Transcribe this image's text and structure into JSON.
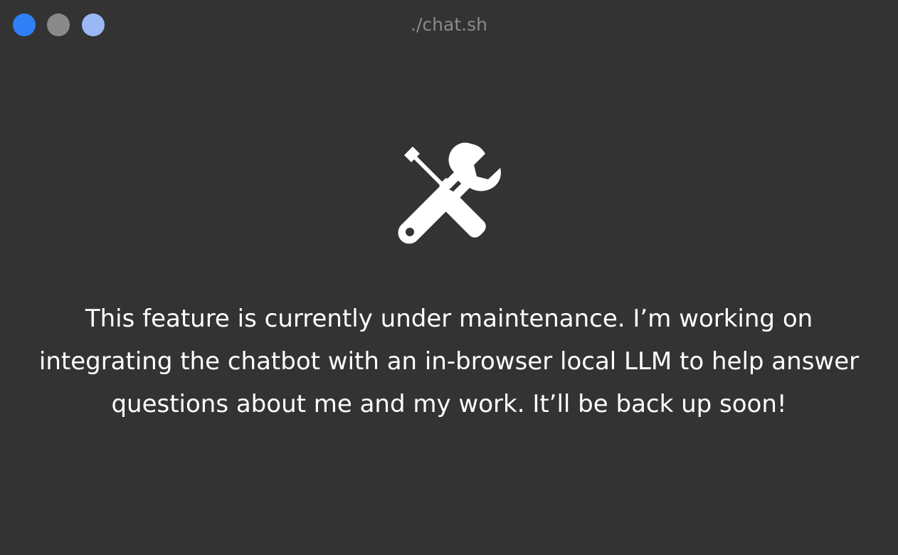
{
  "window": {
    "title": "./chat.sh",
    "controls": [
      {
        "name": "close",
        "color": "#2f7ff7"
      },
      {
        "name": "minimize",
        "color": "#8a8a8a"
      },
      {
        "name": "maximize",
        "color": "#9ab8f5"
      }
    ]
  },
  "main": {
    "icon": "tools-icon",
    "message": "This feature is currently under maintenance. I’m working on integrating the chatbot with an in-browser local LLM to help answer questions about me and my work. It’ll be back up soon!"
  }
}
